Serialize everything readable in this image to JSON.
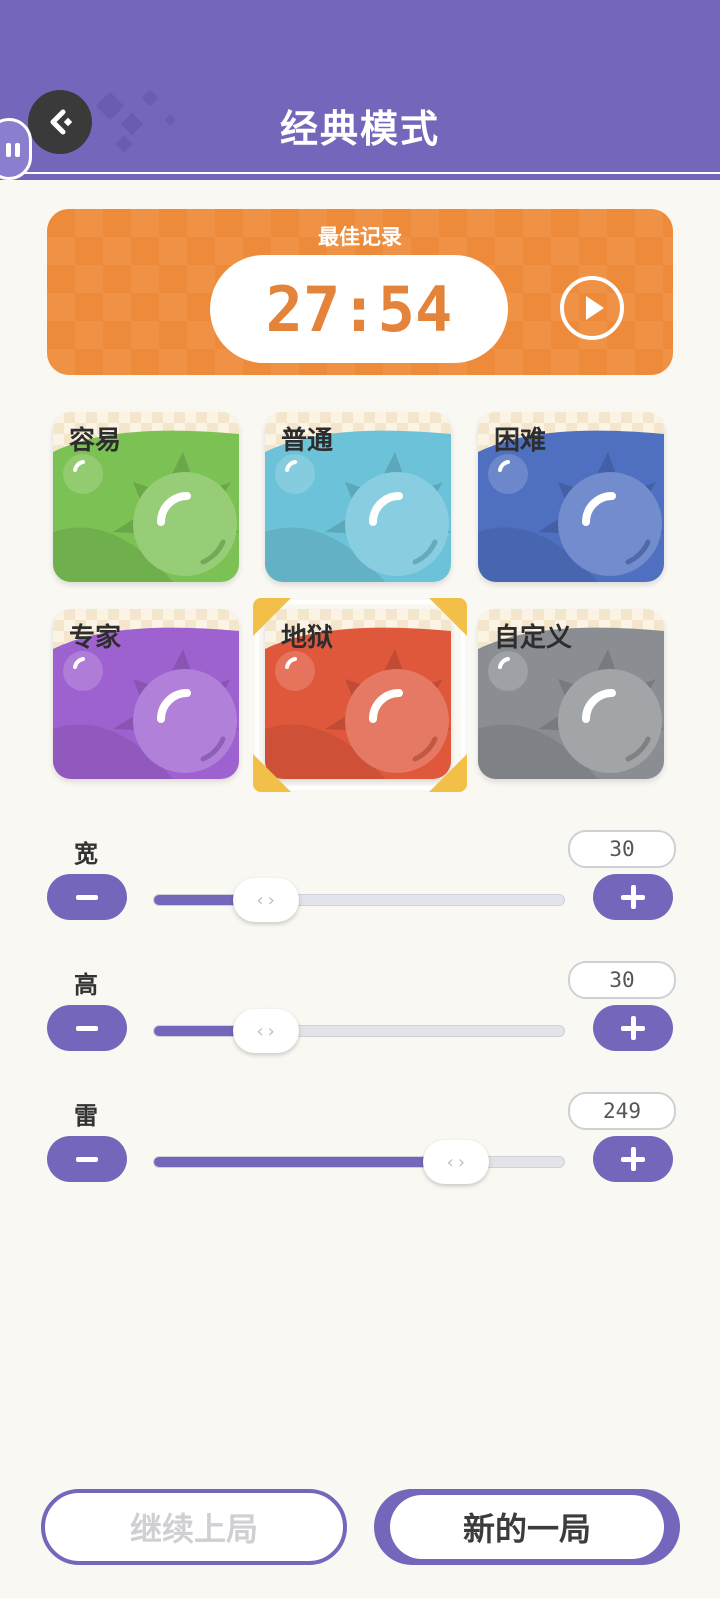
{
  "header": {
    "title": "经典模式"
  },
  "best_record": {
    "label": "最佳记录",
    "time": "27:54"
  },
  "modes": [
    {
      "label": "容易",
      "color": "#7cc154",
      "selected": false
    },
    {
      "label": "普通",
      "color": "#6cc2d8",
      "selected": false
    },
    {
      "label": "困难",
      "color": "#4f6fc0",
      "selected": false
    },
    {
      "label": "专家",
      "color": "#9e62d0",
      "selected": false
    },
    {
      "label": "地狱",
      "color": "#e0583c",
      "selected": true
    },
    {
      "label": "自定义",
      "color": "#8a8e92",
      "selected": false
    }
  ],
  "params": [
    {
      "label": "宽",
      "value": "30",
      "fraction": 0.23
    },
    {
      "label": "高",
      "value": "30",
      "fraction": 0.23
    },
    {
      "label": "雷",
      "value": "249",
      "fraction": 0.78
    }
  ],
  "buttons": {
    "continue": "继续上局",
    "new_game": "新的一局"
  },
  "colors": {
    "accent": "#7467bb",
    "best_card": "#ee8b3a"
  }
}
